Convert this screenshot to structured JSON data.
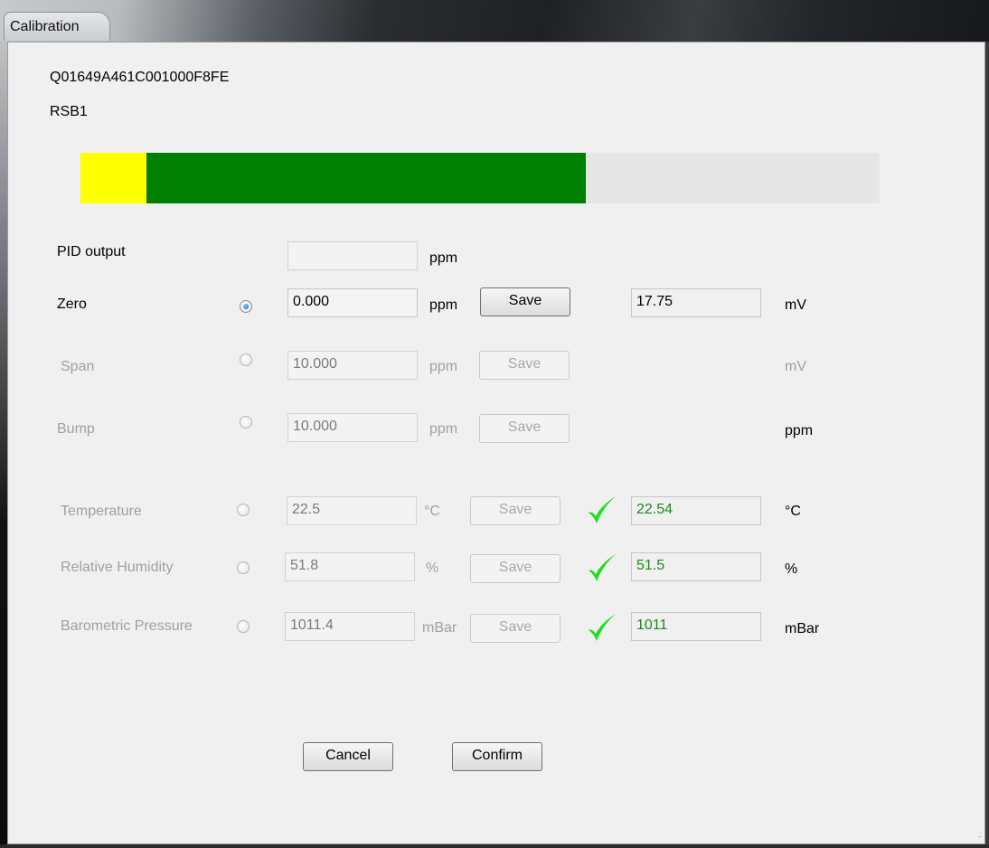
{
  "window": {
    "title": "Calibration"
  },
  "device": {
    "id": "Q01649A461C001000F8FE",
    "name": "RSB1"
  },
  "progress": {
    "yellow_fraction": 0.083,
    "green_fraction": 0.55,
    "yellow": "#ffff00",
    "green": "#008000",
    "track": "#e6e6e6"
  },
  "rows": {
    "pid": {
      "label": "PID output",
      "value": "",
      "unit": "ppm"
    },
    "zero": {
      "label": "Zero",
      "selected": true,
      "value": "0.000",
      "unit": "ppm",
      "save": "Save",
      "reading": "17.75",
      "reading_unit": "mV"
    },
    "span": {
      "label": "Span",
      "selected": false,
      "value": "10.000",
      "unit": "ppm",
      "save": "Save",
      "reading_unit": "mV"
    },
    "bump": {
      "label": "Bump",
      "selected": false,
      "value": "10.000",
      "unit": "ppm",
      "save": "Save",
      "reading_unit": "ppm"
    },
    "temperature": {
      "label": "Temperature",
      "selected": false,
      "value": "22.5",
      "unit": "°C",
      "save": "Save",
      "check_icon": "checkmark-icon",
      "reading": "22.54",
      "reading_unit": "°C"
    },
    "humidity": {
      "label": "Relative Humidity",
      "selected": false,
      "value": "51.8",
      "unit": "%",
      "save": "Save",
      "check_icon": "checkmark-icon",
      "reading": "51.5",
      "reading_unit": "%"
    },
    "pressure": {
      "label": "Barometric Pressure",
      "selected": false,
      "value": "1011.4",
      "unit": "mBar",
      "save": "Save",
      "check_icon": "checkmark-icon",
      "reading": "1011",
      "reading_unit": "mBar"
    }
  },
  "actions": {
    "cancel": "Cancel",
    "confirm": "Confirm"
  },
  "colors": {
    "check": "#22dd22",
    "reading_green": "#1a8a1a",
    "disabled_text": "#a0a0a0"
  }
}
